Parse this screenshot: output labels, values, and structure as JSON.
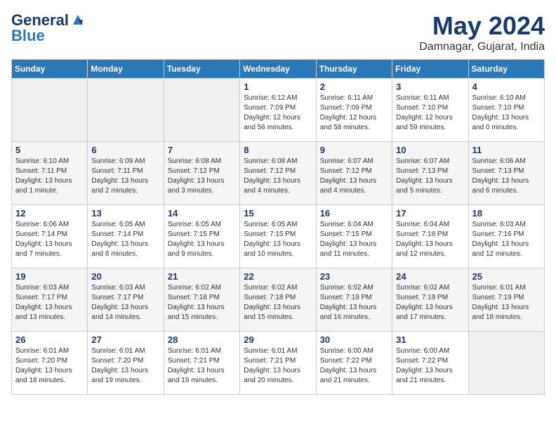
{
  "logo": {
    "line1": "General",
    "line2": "Blue"
  },
  "title": "May 2024",
  "location": "Damnagar, Gujarat, India",
  "weekdays": [
    "Sunday",
    "Monday",
    "Tuesday",
    "Wednesday",
    "Thursday",
    "Friday",
    "Saturday"
  ],
  "weeks": [
    [
      {
        "day": "",
        "info": ""
      },
      {
        "day": "",
        "info": ""
      },
      {
        "day": "",
        "info": ""
      },
      {
        "day": "1",
        "info": "Sunrise: 6:12 AM\nSunset: 7:09 PM\nDaylight: 12 hours\nand 56 minutes."
      },
      {
        "day": "2",
        "info": "Sunrise: 6:11 AM\nSunset: 7:09 PM\nDaylight: 12 hours\nand 58 minutes."
      },
      {
        "day": "3",
        "info": "Sunrise: 6:11 AM\nSunset: 7:10 PM\nDaylight: 12 hours\nand 59 minutes."
      },
      {
        "day": "4",
        "info": "Sunrise: 6:10 AM\nSunset: 7:10 PM\nDaylight: 13 hours\nand 0 minutes."
      }
    ],
    [
      {
        "day": "5",
        "info": "Sunrise: 6:10 AM\nSunset: 7:11 PM\nDaylight: 13 hours\nand 1 minute."
      },
      {
        "day": "6",
        "info": "Sunrise: 6:09 AM\nSunset: 7:11 PM\nDaylight: 13 hours\nand 2 minutes."
      },
      {
        "day": "7",
        "info": "Sunrise: 6:08 AM\nSunset: 7:12 PM\nDaylight: 13 hours\nand 3 minutes."
      },
      {
        "day": "8",
        "info": "Sunrise: 6:08 AM\nSunset: 7:12 PM\nDaylight: 13 hours\nand 4 minutes."
      },
      {
        "day": "9",
        "info": "Sunrise: 6:07 AM\nSunset: 7:12 PM\nDaylight: 13 hours\nand 4 minutes."
      },
      {
        "day": "10",
        "info": "Sunrise: 6:07 AM\nSunset: 7:13 PM\nDaylight: 13 hours\nand 5 minutes."
      },
      {
        "day": "11",
        "info": "Sunrise: 6:06 AM\nSunset: 7:13 PM\nDaylight: 13 hours\nand 6 minutes."
      }
    ],
    [
      {
        "day": "12",
        "info": "Sunrise: 6:06 AM\nSunset: 7:14 PM\nDaylight: 13 hours\nand 7 minutes."
      },
      {
        "day": "13",
        "info": "Sunrise: 6:05 AM\nSunset: 7:14 PM\nDaylight: 13 hours\nand 8 minutes."
      },
      {
        "day": "14",
        "info": "Sunrise: 6:05 AM\nSunset: 7:15 PM\nDaylight: 13 hours\nand 9 minutes."
      },
      {
        "day": "15",
        "info": "Sunrise: 6:05 AM\nSunset: 7:15 PM\nDaylight: 13 hours\nand 10 minutes."
      },
      {
        "day": "16",
        "info": "Sunrise: 6:04 AM\nSunset: 7:15 PM\nDaylight: 13 hours\nand 11 minutes."
      },
      {
        "day": "17",
        "info": "Sunrise: 6:04 AM\nSunset: 7:16 PM\nDaylight: 13 hours\nand 12 minutes."
      },
      {
        "day": "18",
        "info": "Sunrise: 6:03 AM\nSunset: 7:16 PM\nDaylight: 13 hours\nand 12 minutes."
      }
    ],
    [
      {
        "day": "19",
        "info": "Sunrise: 6:03 AM\nSunset: 7:17 PM\nDaylight: 13 hours\nand 13 minutes."
      },
      {
        "day": "20",
        "info": "Sunrise: 6:03 AM\nSunset: 7:17 PM\nDaylight: 13 hours\nand 14 minutes."
      },
      {
        "day": "21",
        "info": "Sunrise: 6:02 AM\nSunset: 7:18 PM\nDaylight: 13 hours\nand 15 minutes."
      },
      {
        "day": "22",
        "info": "Sunrise: 6:02 AM\nSunset: 7:18 PM\nDaylight: 13 hours\nand 15 minutes."
      },
      {
        "day": "23",
        "info": "Sunrise: 6:02 AM\nSunset: 7:19 PM\nDaylight: 13 hours\nand 16 minutes."
      },
      {
        "day": "24",
        "info": "Sunrise: 6:02 AM\nSunset: 7:19 PM\nDaylight: 13 hours\nand 17 minutes."
      },
      {
        "day": "25",
        "info": "Sunrise: 6:01 AM\nSunset: 7:19 PM\nDaylight: 13 hours\nand 18 minutes."
      }
    ],
    [
      {
        "day": "26",
        "info": "Sunrise: 6:01 AM\nSunset: 7:20 PM\nDaylight: 13 hours\nand 18 minutes."
      },
      {
        "day": "27",
        "info": "Sunrise: 6:01 AM\nSunset: 7:20 PM\nDaylight: 13 hours\nand 19 minutes."
      },
      {
        "day": "28",
        "info": "Sunrise: 6:01 AM\nSunset: 7:21 PM\nDaylight: 13 hours\nand 19 minutes."
      },
      {
        "day": "29",
        "info": "Sunrise: 6:01 AM\nSunset: 7:21 PM\nDaylight: 13 hours\nand 20 minutes."
      },
      {
        "day": "30",
        "info": "Sunrise: 6:00 AM\nSunset: 7:22 PM\nDaylight: 13 hours\nand 21 minutes."
      },
      {
        "day": "31",
        "info": "Sunrise: 6:00 AM\nSunset: 7:22 PM\nDaylight: 13 hours\nand 21 minutes."
      },
      {
        "day": "",
        "info": ""
      }
    ]
  ]
}
